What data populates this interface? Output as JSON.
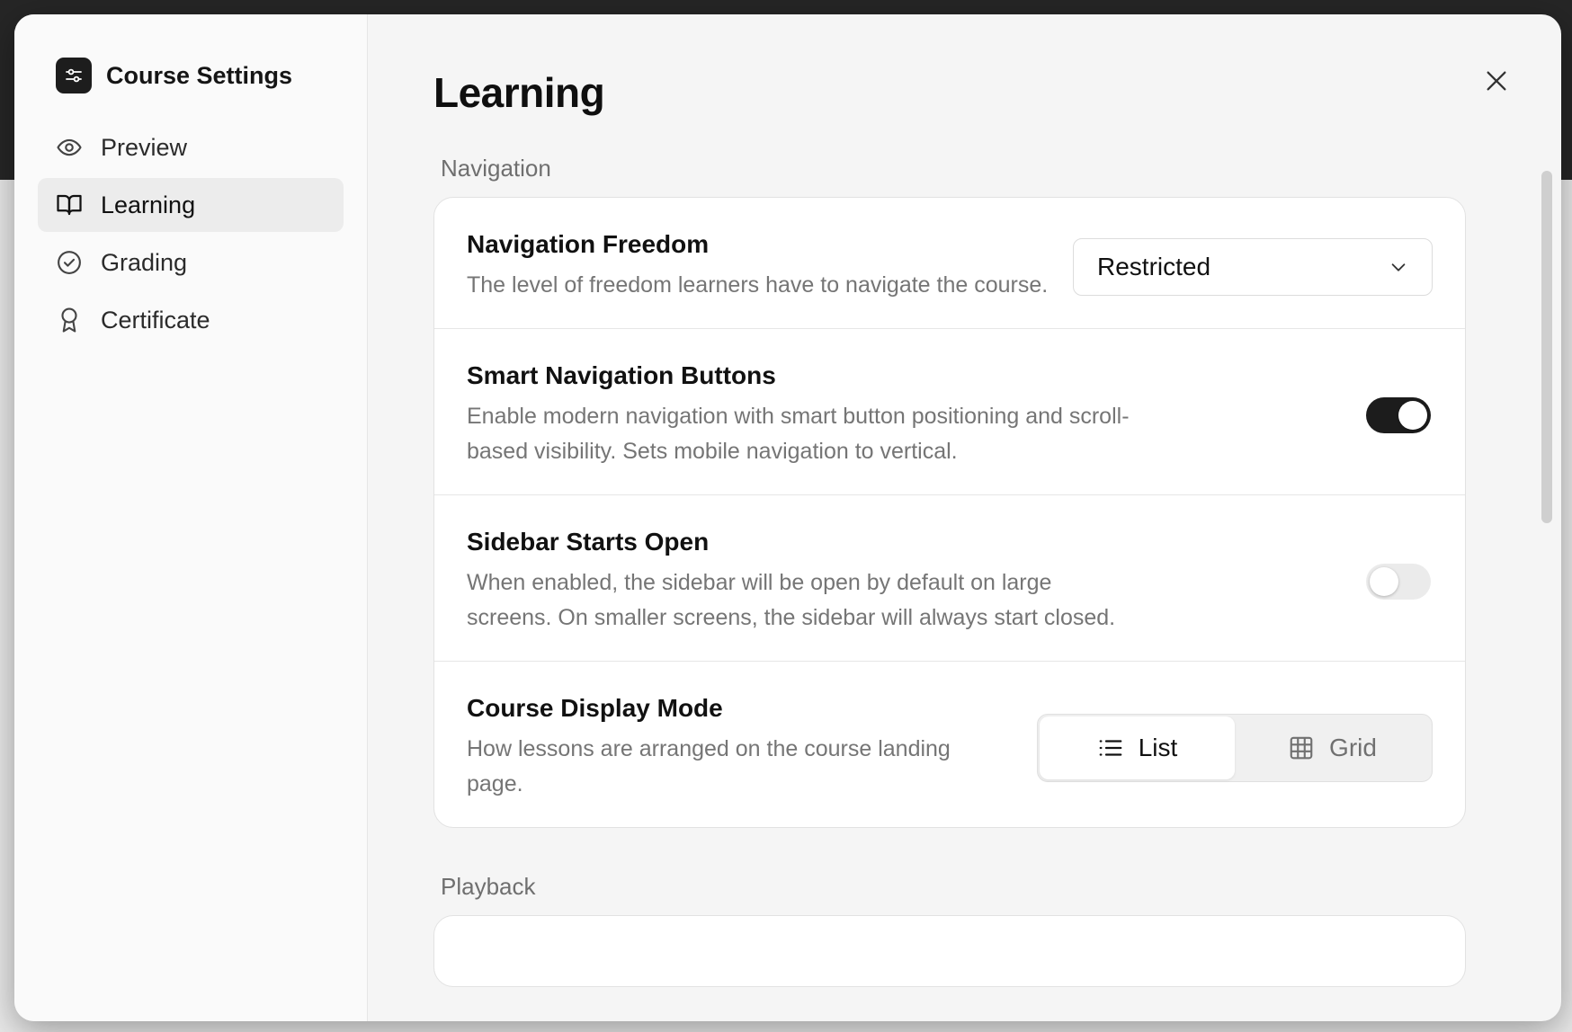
{
  "sidebar": {
    "title": "Course Settings",
    "items": [
      {
        "label": "Preview",
        "icon": "eye-icon"
      },
      {
        "label": "Learning",
        "icon": "book-open-icon",
        "active": true
      },
      {
        "label": "Grading",
        "icon": "check-circle-icon"
      },
      {
        "label": "Certificate",
        "icon": "award-icon"
      }
    ]
  },
  "page": {
    "title": "Learning"
  },
  "sections": {
    "navigation": {
      "label": "Navigation",
      "freedom": {
        "title": "Navigation Freedom",
        "description": "The level of freedom learners have to navigate the course.",
        "value": "Restricted"
      },
      "smart_buttons": {
        "title": "Smart Navigation Buttons",
        "description": "Enable modern navigation with smart button positioning and scroll-based visibility. Sets mobile navigation to vertical.",
        "enabled": true
      },
      "sidebar_open": {
        "title": "Sidebar Starts Open",
        "description": "When enabled, the sidebar will be open by default on large screens. On smaller screens, the sidebar will always start closed.",
        "enabled": false
      },
      "display_mode": {
        "title": "Course Display Mode",
        "description": "How lessons are arranged on the course landing page.",
        "options": [
          "List",
          "Grid"
        ],
        "selected": "List"
      }
    },
    "playback": {
      "label": "Playback"
    }
  },
  "colors": {
    "accent": "#1c1c1c",
    "muted_text": "#757575",
    "panel_bg": "#f5f5f5"
  }
}
